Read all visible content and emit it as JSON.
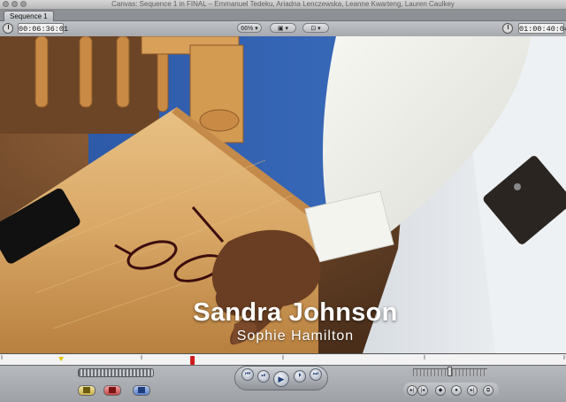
{
  "window": {
    "title": "Canvas: Sequence 1 in FINAL – Emmanuel Tedeku, Ariadna Lenczewska, Leanne Kwarteng, Lauren Caulkey"
  },
  "tabs": [
    {
      "label": "Sequence 1"
    }
  ],
  "toolbar": {
    "duration_timecode": "00:06:36:01",
    "zoom_value": "66%",
    "view_mode_icon": "image-display-icon",
    "overlay_icon": "overlay-icon",
    "current_timecode": "01:00:40:04"
  },
  "video": {
    "title_name": "Sandra Johnson",
    "title_subtitle": "Sophie Hamilton"
  },
  "playback": {
    "playhead_fraction": 0.34,
    "in_point_fraction": 0.108
  },
  "colors": {
    "accent_play": "#1f3f7a",
    "playhead": "#d11a1a",
    "in_marker": "#e0c400"
  }
}
